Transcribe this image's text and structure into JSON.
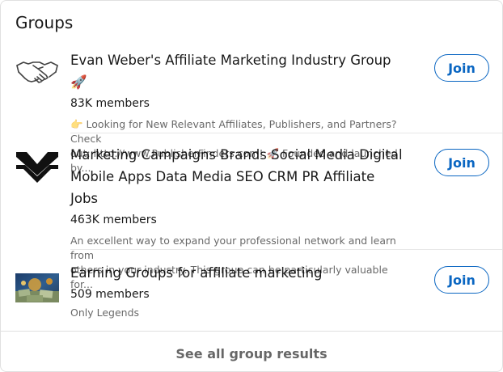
{
  "section": {
    "title": "Groups"
  },
  "groups": [
    {
      "title": "Evan Weber's Affiliate Marketing Industry Group 🚀",
      "members": "83K members",
      "desc_line1": "👉 Looking for New Relevant Affiliates, Publishers, and Partners? Check",
      "desc_line2": "out: http://www.PublisherFinders.com! 🚀 Founded and launched by...",
      "join_label": "Join",
      "icon": "handshake-icon"
    },
    {
      "title_line1": "Marketing Campaigns Brands Social Media Digital",
      "title_line2": "Mobile Apps Data Media SEO CRM PR Affiliate Jobs",
      "members": "463K members",
      "desc_line1": "An excellent way to expand your professional network and learn from",
      "desc_line2": "others in your industry. This group can be particularly valuable for...",
      "join_label": "Join",
      "icon": "mw-logo-icon"
    },
    {
      "title": "Earning Groups for affiliate marketing",
      "members": "509 members",
      "desc_line1": "Only Legends",
      "join_label": "Join",
      "icon": "money-photo"
    }
  ],
  "footer": {
    "see_all": "See all group results"
  },
  "colors": {
    "accent": "#0a66c2",
    "muted": "#666666"
  }
}
